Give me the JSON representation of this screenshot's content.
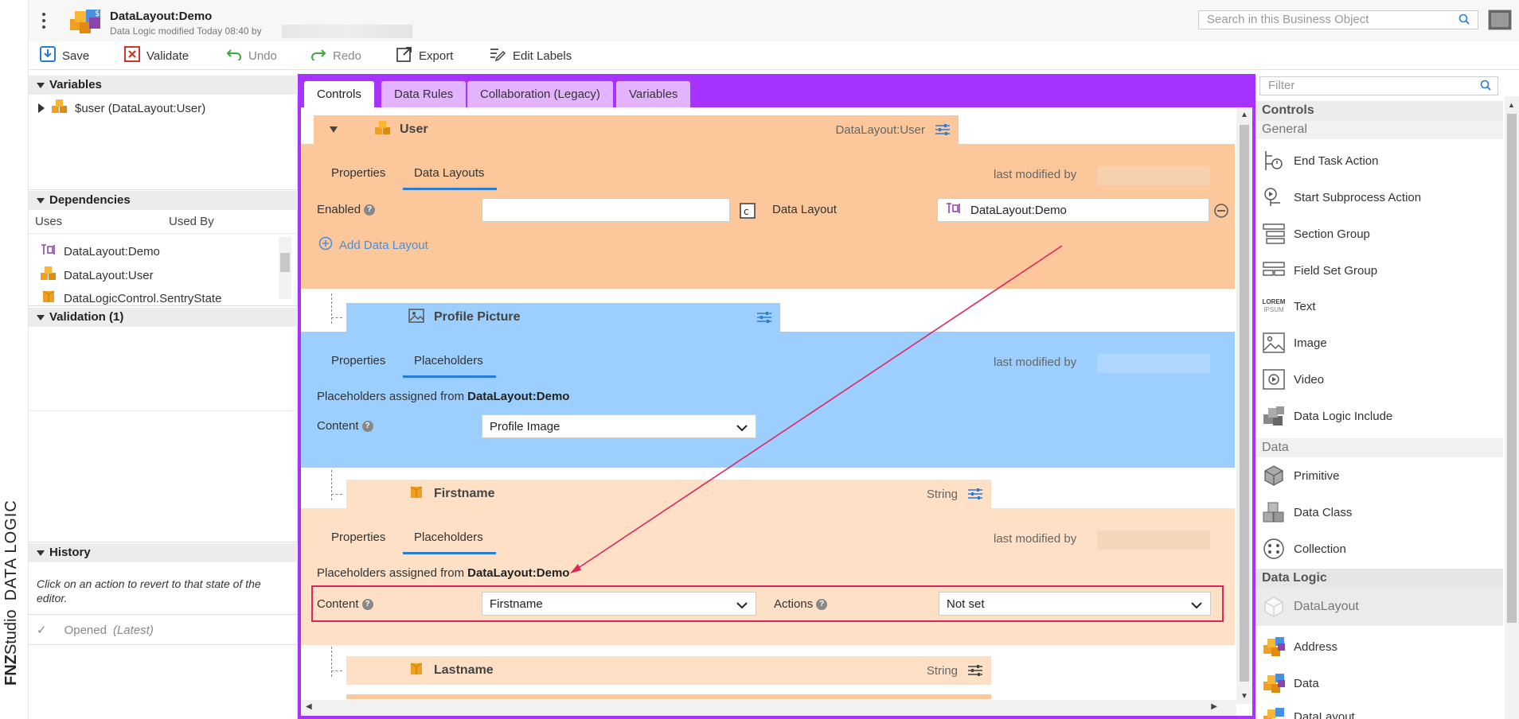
{
  "brand": {
    "part1": "FNZ",
    "part2": "Studio",
    "part3": "DATA LOGIC"
  },
  "header": {
    "title": "DataLayout:Demo",
    "subtitle": "Data Logic modified Today 08:40 by",
    "search_placeholder": "Search in this Business Object"
  },
  "toolbar": {
    "save": "Save",
    "validate": "Validate",
    "undo": "Undo",
    "redo": "Redo",
    "export": "Export",
    "edit_labels": "Edit Labels"
  },
  "left": {
    "variables_title": "Variables",
    "variable_item": "$user (DataLayout:User)",
    "dependencies_title": "Dependencies",
    "dep_tabs": [
      "Uses",
      "Used By"
    ],
    "dep_items": [
      "DataLayout:Demo",
      "DataLayout:User",
      "DataLogicControl.SentryState"
    ],
    "validation_title": "Validation (1)",
    "history_title": "History",
    "history_hint": "Click on an action to revert to that state of the editor.",
    "history_item": "Opened",
    "history_item_tag": "(Latest)"
  },
  "center": {
    "tabs": [
      "Controls",
      "Data Rules",
      "Collaboration (Legacy)",
      "Variables"
    ],
    "user": {
      "title": "User",
      "type": "DataLayout:User",
      "subtabs": [
        "Properties",
        "Data Layouts"
      ],
      "last_modified": "last modified by",
      "enabled_label": "Enabled",
      "data_layout_label": "Data Layout",
      "data_layout_value": "DataLayout:Demo",
      "add_link": "Add Data Layout"
    },
    "picture": {
      "title": "Profile Picture",
      "subtabs": [
        "Properties",
        "Placeholders"
      ],
      "last_modified": "last modified by",
      "assigned_prefix": "Placeholders assigned from",
      "assigned_source": "DataLayout:Demo",
      "content_label": "Content",
      "content_value": "Profile Image"
    },
    "firstname": {
      "title": "Firstname",
      "type": "String",
      "subtabs": [
        "Properties",
        "Placeholders"
      ],
      "last_modified": "last modified by",
      "assigned_prefix": "Placeholders assigned from",
      "assigned_source": "DataLayout:Demo",
      "content_label": "Content",
      "content_value": "Firstname",
      "actions_label": "Actions",
      "actions_value": "Not set"
    },
    "lastname": {
      "title": "Lastname",
      "type": "String"
    }
  },
  "right": {
    "filter_placeholder": "Filter",
    "controls_title": "Controls",
    "general_title": "General",
    "general_items": [
      "End Task Action",
      "Start Subprocess Action",
      "Section Group",
      "Field Set Group",
      "Text",
      "Image",
      "Video",
      "Data Logic Include"
    ],
    "data_title": "Data",
    "data_items": [
      "Primitive",
      "Data Class",
      "Collection"
    ],
    "logic_title": "Data Logic",
    "logic_items": [
      "DataLayout",
      "Address",
      "Data",
      "DataLayout"
    ]
  },
  "colors": {
    "accent_purple": "#a633ff",
    "user_orange": "#fcc89b",
    "picture_blue": "#9ccffd",
    "field_peach": "#fde0c6",
    "highlight_pink": "#e0245e"
  }
}
